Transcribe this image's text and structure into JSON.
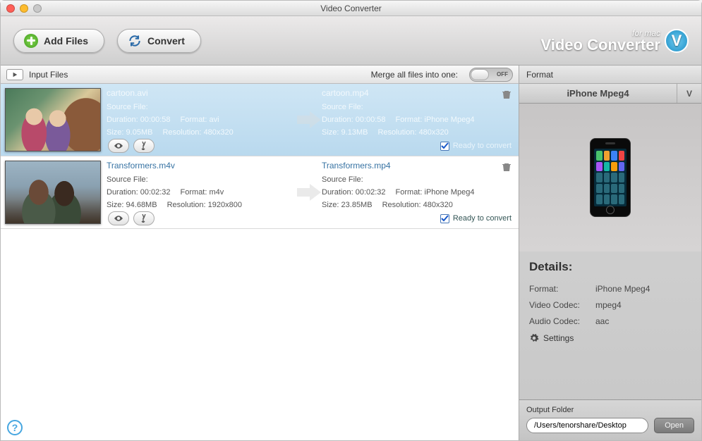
{
  "window": {
    "title": "Video Converter"
  },
  "toolbar": {
    "add_files": "Add Files",
    "convert": "Convert",
    "brand_sub": "for mac",
    "brand_main": "Video Converter",
    "brand_logo_letter": "V"
  },
  "left_header": {
    "title": "Input Files",
    "merge_label": "Merge all files into one:",
    "toggle_state": "OFF"
  },
  "files": [
    {
      "selected": true,
      "thumb": "anime",
      "src": {
        "name": "cartoon.avi",
        "source_file_label": "Source File:",
        "duration_label": "Duration:",
        "duration": "00:00:58",
        "format_label": "Format:",
        "format": "avi",
        "size_label": "Size:",
        "size": "9.05MB",
        "resolution_label": "Resolution:",
        "resolution": "480x320"
      },
      "dst": {
        "name": "cartoon.mp4",
        "source_file_label": "Source File:",
        "duration_label": "Duration:",
        "duration": "00:00:58",
        "format_label": "Format:",
        "format": "iPhone Mpeg4",
        "size_label": "Size:",
        "size": "9.13MB",
        "resolution_label": "Resolution:",
        "resolution": "480x320"
      },
      "ready_label": "Ready to convert"
    },
    {
      "selected": false,
      "thumb": "movie",
      "src": {
        "name": "Transformers.m4v",
        "source_file_label": "Source File:",
        "duration_label": "Duration:",
        "duration": "00:02:32",
        "format_label": "Format:",
        "format": "m4v",
        "size_label": "Size:",
        "size": "94.68MB",
        "resolution_label": "Resolution:",
        "resolution": "1920x800"
      },
      "dst": {
        "name": "Transformers.mp4",
        "source_file_label": "Source File:",
        "duration_label": "Duration:",
        "duration": "00:02:32",
        "format_label": "Format:",
        "format": "iPhone Mpeg4",
        "size_label": "Size:",
        "size": "23.85MB",
        "resolution_label": "Resolution:",
        "resolution": "480x320"
      },
      "ready_label": "Ready to convert"
    }
  ],
  "right": {
    "header": "Format",
    "selected_format": "iPhone Mpeg4",
    "dropdown_letter": "V",
    "details_heading": "Details:",
    "format_label": "Format:",
    "format_value": "iPhone Mpeg4",
    "vcodec_label": "Video Codec:",
    "vcodec_value": "mpeg4",
    "acodec_label": "Audio Codec:",
    "acodec_value": "aac",
    "settings_label": "Settings",
    "output_folder_label": "Output Folder",
    "output_folder_path": "/Users/tenorshare/Desktop",
    "open_label": "Open"
  },
  "help_glyph": "?"
}
